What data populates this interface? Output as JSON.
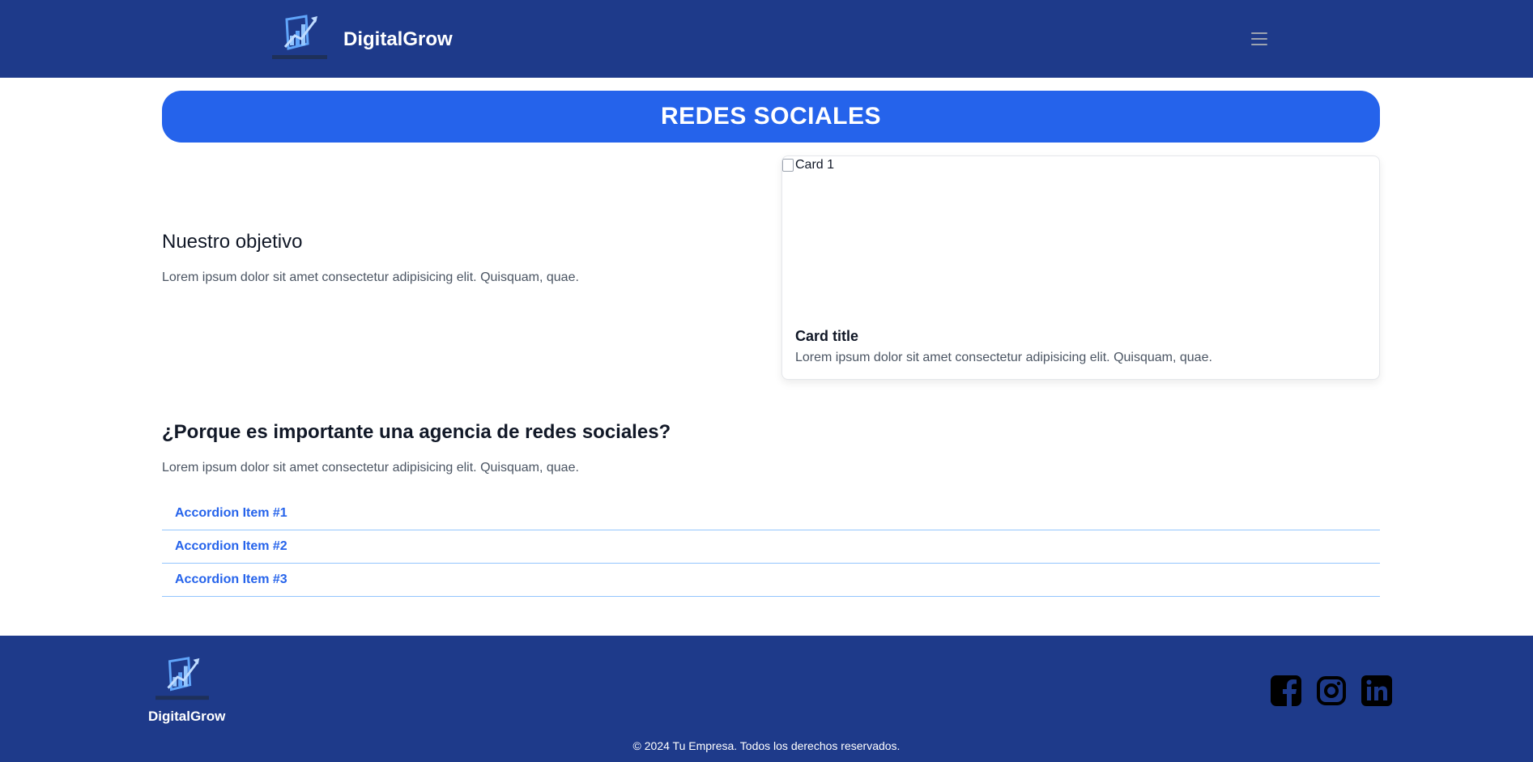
{
  "nav": {
    "brand": "DigitalGrow",
    "logo_icon": "growth-chart-logo",
    "menu_icon": "hamburger-menu-icon"
  },
  "banner": {
    "title": "REDES SOCIALES"
  },
  "objective": {
    "title": "Nuestro objetivo",
    "text": "Lorem ipsum dolor sit amet consectetur adipisicing elit. Quisquam, quae."
  },
  "card": {
    "image_alt": "Card 1",
    "title": "Card title",
    "text": "Lorem ipsum dolor sit amet consectetur adipisicing elit. Quisquam, quae."
  },
  "why": {
    "title": "¿Porque es importante una agencia de redes sociales?",
    "text": "Lorem ipsum dolor sit amet consectetur adipisicing elit. Quisquam, quae."
  },
  "accordion": {
    "items": [
      {
        "label": "Accordion Item #1"
      },
      {
        "label": "Accordion Item #2"
      },
      {
        "label": "Accordion Item #3"
      }
    ]
  },
  "footer": {
    "brand": "DigitalGrow",
    "copyright": "© 2024 Tu Empresa. Todos los derechos reservados.",
    "social_icons": [
      "facebook-icon",
      "instagram-icon",
      "linkedin-icon"
    ]
  },
  "colors": {
    "navbar_bg": "#1e3a8a",
    "banner_bg": "#2563eb",
    "accordion_text": "#2563eb",
    "accordion_divider": "#93c5fd"
  }
}
